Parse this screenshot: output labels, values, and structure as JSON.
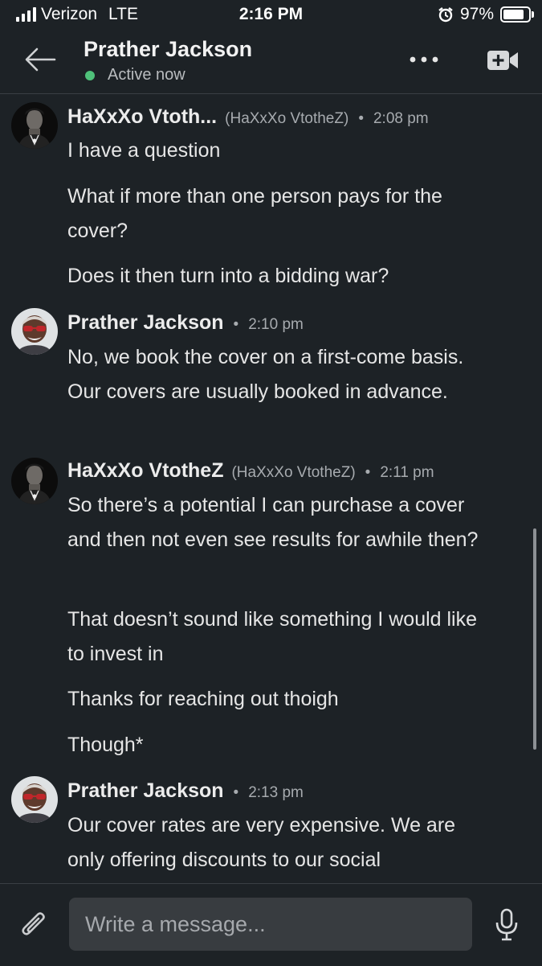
{
  "status_bar": {
    "carrier": "Verizon",
    "network": "LTE",
    "time": "2:16 PM",
    "battery": "97%",
    "battery_level": 0.97,
    "icons": [
      "signal-icon",
      "alarm-icon",
      "battery-icon"
    ]
  },
  "header": {
    "title": "Prather Jackson",
    "presence": "Active now",
    "presence_color": "#4fc17a",
    "icons": [
      "back-arrow-icon",
      "more-icon",
      "video-call-icon"
    ]
  },
  "messages": [
    {
      "sender": "HaXxXo Vtoth...",
      "handle": "(HaXxXo VtotheZ)",
      "separator": "•",
      "time": "2:08 pm",
      "lines": [
        "I have a question",
        "What if more than one person pays for the cover?",
        "Does it then turn into a bidding war?"
      ]
    },
    {
      "sender": "Prather Jackson",
      "handle": "",
      "separator": "•",
      "time": "2:10 pm",
      "lines": [
        "No, we book the cover on a first-come basis. Our covers are usually booked in advance."
      ]
    },
    {
      "sender": "HaXxXo VtotheZ",
      "handle": "(HaXxXo VtotheZ)",
      "separator": "•",
      "time": "2:11 pm",
      "lines": [
        "So there’s a potential I can purchase a cover and then not even see results for awhile then?",
        "That doesn’t sound like something I would like to invest in",
        "Thanks for reaching out thoigh",
        "Though*"
      ]
    },
    {
      "sender": "Prather Jackson",
      "handle": "",
      "separator": "•",
      "time": "2:13 pm",
      "lines": [
        "Our cover rates are very expensive. We are only offering discounts to our social"
      ]
    }
  ],
  "composer": {
    "placeholder": "Write a message...",
    "icons": [
      "paperclip-icon",
      "microphone-icon"
    ]
  },
  "colors": {
    "background": "#1d2226",
    "input_background": "#383c40",
    "divider": "#3a3f44"
  }
}
